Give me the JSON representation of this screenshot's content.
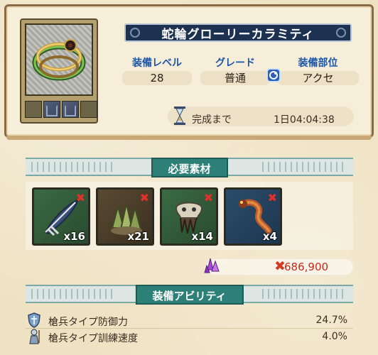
{
  "item": {
    "name": "蛇輪グローリーカラミティ",
    "stats": [
      {
        "label": "装備レベル",
        "value": "28"
      },
      {
        "label": "グレード",
        "value": "普通"
      },
      {
        "label": "装備部位",
        "value": "アクセ"
      }
    ],
    "time_label": "完成まで",
    "time_value": "1日04:04:38"
  },
  "sections": {
    "materials_title": "必要素材",
    "ability_title": "装備アビリティ"
  },
  "materials": [
    {
      "name": "feather",
      "qty": "x16"
    },
    {
      "name": "scales",
      "qty": "x21"
    },
    {
      "name": "skull",
      "qty": "x14"
    },
    {
      "name": "serpent",
      "qty": "x4"
    }
  ],
  "cost": {
    "value": "686,900"
  },
  "abilities": [
    {
      "label": "槍兵タイプ防御力",
      "value": "24.7%"
    },
    {
      "label": "槍兵タイプ訓練速度",
      "value": "4.0%"
    }
  ],
  "colors": {
    "banner": "#1d3150",
    "section": "#2c8077",
    "stat_label": "#1e56a6",
    "cost": "#c8281e"
  }
}
